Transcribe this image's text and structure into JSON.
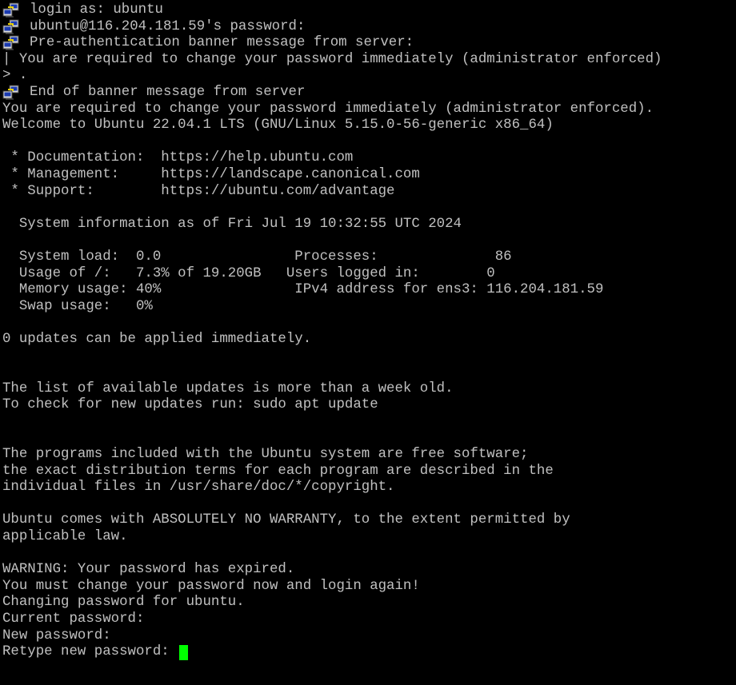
{
  "terminal": {
    "colors": {
      "background": "#000000",
      "foreground": "#c0c0c0",
      "cursor": "#00ff00"
    },
    "icon": "putty-icon",
    "lines": [
      {
        "icon": true,
        "text": "login as: ubuntu"
      },
      {
        "icon": true,
        "text": "ubuntu@116.204.181.59's password:"
      },
      {
        "icon": true,
        "text": "Pre-authentication banner message from server:"
      },
      {
        "icon": false,
        "text": "| You are required to change your password immediately (administrator enforced)"
      },
      {
        "icon": false,
        "text": "> ."
      },
      {
        "icon": true,
        "text": "End of banner message from server"
      },
      {
        "icon": false,
        "text": "You are required to change your password immediately (administrator enforced)."
      },
      {
        "icon": false,
        "text": "Welcome to Ubuntu 22.04.1 LTS (GNU/Linux 5.15.0-56-generic x86_64)"
      },
      {
        "icon": false,
        "text": ""
      },
      {
        "icon": false,
        "text": " * Documentation:  https://help.ubuntu.com"
      },
      {
        "icon": false,
        "text": " * Management:     https://landscape.canonical.com"
      },
      {
        "icon": false,
        "text": " * Support:        https://ubuntu.com/advantage"
      },
      {
        "icon": false,
        "text": ""
      },
      {
        "icon": false,
        "text": "  System information as of Fri Jul 19 10:32:55 UTC 2024"
      },
      {
        "icon": false,
        "text": ""
      },
      {
        "icon": false,
        "text": "  System load:  0.0                Processes:              86"
      },
      {
        "icon": false,
        "text": "  Usage of /:   7.3% of 19.20GB   Users logged in:        0"
      },
      {
        "icon": false,
        "text": "  Memory usage: 40%                IPv4 address for ens3: 116.204.181.59"
      },
      {
        "icon": false,
        "text": "  Swap usage:   0%"
      },
      {
        "icon": false,
        "text": ""
      },
      {
        "icon": false,
        "text": "0 updates can be applied immediately."
      },
      {
        "icon": false,
        "text": ""
      },
      {
        "icon": false,
        "text": ""
      },
      {
        "icon": false,
        "text": "The list of available updates is more than a week old."
      },
      {
        "icon": false,
        "text": "To check for new updates run: sudo apt update"
      },
      {
        "icon": false,
        "text": ""
      },
      {
        "icon": false,
        "text": ""
      },
      {
        "icon": false,
        "text": "The programs included with the Ubuntu system are free software;"
      },
      {
        "icon": false,
        "text": "the exact distribution terms for each program are described in the"
      },
      {
        "icon": false,
        "text": "individual files in /usr/share/doc/*/copyright."
      },
      {
        "icon": false,
        "text": ""
      },
      {
        "icon": false,
        "text": "Ubuntu comes with ABSOLUTELY NO WARRANTY, to the extent permitted by"
      },
      {
        "icon": false,
        "text": "applicable law."
      },
      {
        "icon": false,
        "text": ""
      },
      {
        "icon": false,
        "text": "WARNING: Your password has expired."
      },
      {
        "icon": false,
        "text": "You must change your password now and login again!"
      },
      {
        "icon": false,
        "text": "Changing password for ubuntu."
      },
      {
        "icon": false,
        "text": "Current password:"
      },
      {
        "icon": false,
        "text": "New password:"
      },
      {
        "icon": false,
        "text": "Retype new password: ",
        "cursor": true
      }
    ]
  }
}
